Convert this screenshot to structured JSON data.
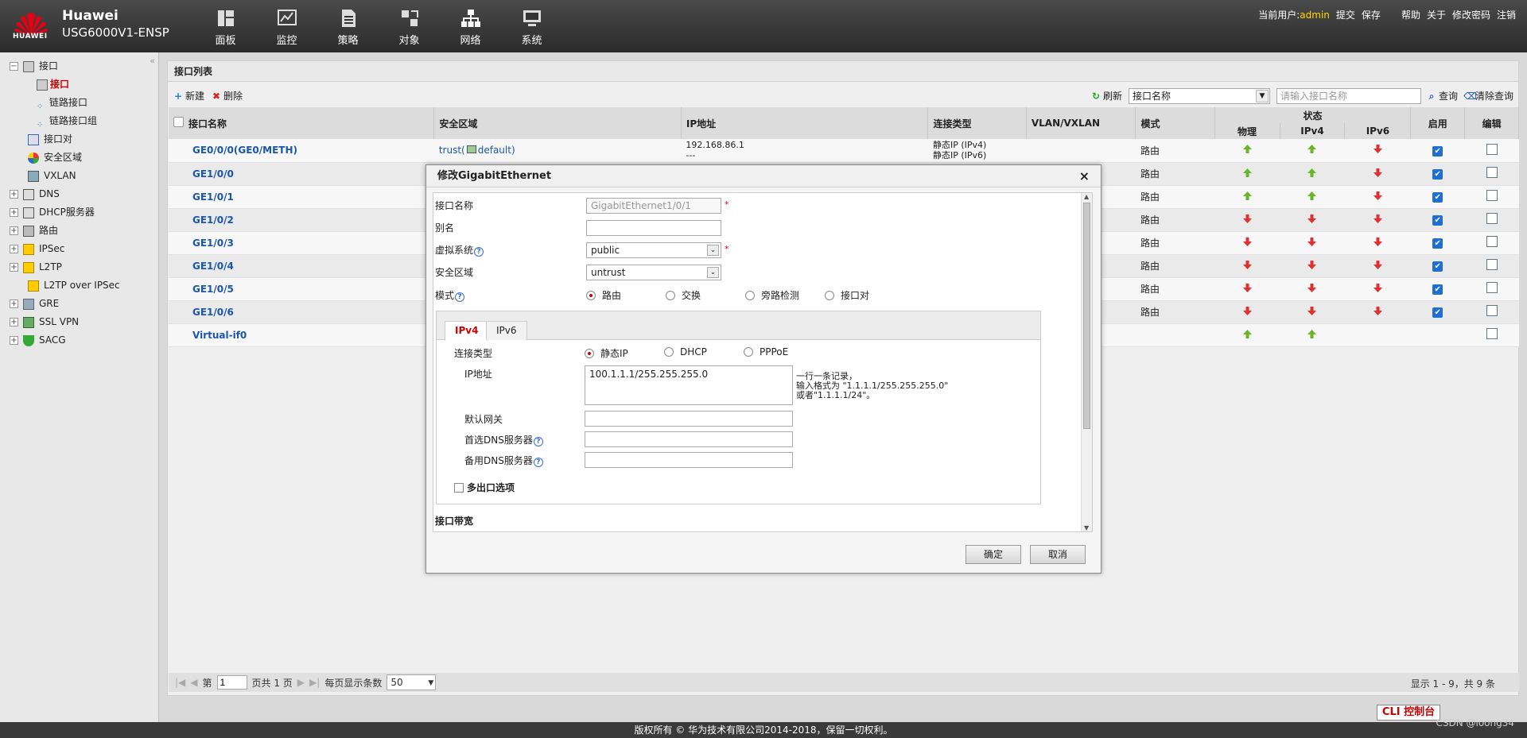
{
  "header": {
    "brand": "Huawei",
    "model": "USG6000V1-ENSP",
    "logo_text": "HUAWEI"
  },
  "nav": [
    {
      "label": "面板",
      "icon": "dashboard-icon"
    },
    {
      "label": "监控",
      "icon": "monitor-icon"
    },
    {
      "label": "策略",
      "icon": "policy-icon"
    },
    {
      "label": "对象",
      "icon": "object-icon"
    },
    {
      "label": "网络",
      "icon": "network-icon"
    },
    {
      "label": "系统",
      "icon": "system-icon"
    }
  ],
  "toplinks": {
    "user_label": "当前用户:",
    "user": "admin",
    "submit": "提交",
    "save": "保存",
    "help": "帮助",
    "about": "关于",
    "change_pwd": "修改密码",
    "logout": "注销"
  },
  "sidebar": {
    "items": [
      {
        "label": "接口",
        "pm": "−"
      },
      {
        "label": "接口",
        "selected": true
      },
      {
        "label": "链路接口"
      },
      {
        "label": "链路接口组"
      },
      {
        "label": "接口对"
      },
      {
        "label": "安全区域"
      },
      {
        "label": "VXLAN"
      },
      {
        "label": "DNS",
        "pm": "+"
      },
      {
        "label": "DHCP服务器",
        "pm": "+"
      },
      {
        "label": "路由",
        "pm": "+"
      },
      {
        "label": "IPSec",
        "pm": "+"
      },
      {
        "label": "L2TP",
        "pm": "+"
      },
      {
        "label": "L2TP over IPSec"
      },
      {
        "label": "GRE",
        "pm": "+"
      },
      {
        "label": "SSL VPN",
        "pm": "+"
      },
      {
        "label": "SACG",
        "pm": "+"
      }
    ]
  },
  "main": {
    "title": "接口列表",
    "new": "新建",
    "delete": "删除",
    "refresh": "刷新",
    "search_field": "接口名称",
    "search_placeholder": "请输入接口名称",
    "query": "查询",
    "clear": "清除查询",
    "columns": {
      "name": "接口名称",
      "zone": "安全区域",
      "ip": "IP地址",
      "conn": "连接类型",
      "vlan": "VLAN/VXLAN",
      "mode": "模式",
      "status": "状态",
      "phys": "物理",
      "ipv4": "IPv4",
      "ipv6": "IPv6",
      "enable": "启用",
      "edit": "编辑"
    },
    "rows": [
      {
        "name": "GE0/0/0(GE0/METH)",
        "zone": "trust(",
        "vsys": "default)",
        "ip": "192.168.86.1",
        "ip2": "---",
        "conn": "静态IP (IPv4)",
        "conn2": "静态IP (IPv6)",
        "mode": "路由",
        "phys": "up",
        "v4": "up",
        "v6": "down"
      },
      {
        "name": "GE1/0/0",
        "mode": "路由",
        "phys": "up",
        "v4": "up",
        "v6": "down"
      },
      {
        "name": "GE1/0/1",
        "mode": "路由",
        "phys": "up",
        "v4": "up",
        "v6": "down"
      },
      {
        "name": "GE1/0/2",
        "mode": "路由",
        "phys": "down",
        "v4": "down",
        "v6": "down"
      },
      {
        "name": "GE1/0/3",
        "mode": "路由",
        "phys": "down",
        "v4": "down",
        "v6": "down"
      },
      {
        "name": "GE1/0/4",
        "mode": "路由",
        "phys": "down",
        "v4": "down",
        "v6": "down"
      },
      {
        "name": "GE1/0/5",
        "mode": "路由",
        "phys": "down",
        "v4": "down",
        "v6": "down"
      },
      {
        "name": "GE1/0/6",
        "mode": "路由",
        "phys": "down",
        "v4": "down",
        "v6": "down"
      },
      {
        "name": "Virtual-if0",
        "mode": "",
        "phys": "up",
        "v4": "up",
        "v6": ""
      }
    ],
    "pager": {
      "page_prefix": "第",
      "page": "1",
      "page_suffix": "页共 1 页",
      "per_page_label": "每页显示条数",
      "per_page": "50",
      "summary": "显示 1 - 9，共 9 条"
    }
  },
  "dialog": {
    "title": "修改GigabitEthernet",
    "name_label": "接口名称",
    "name_value": "GigabitEthernet1/0/1",
    "alias_label": "别名",
    "alias_value": "",
    "vsys_label": "虚拟系统",
    "vsys_value": "public",
    "zone_label": "安全区域",
    "zone_value": "untrust",
    "mode_label": "模式",
    "modes": [
      "路由",
      "交换",
      "旁路检测",
      "接口对"
    ],
    "tabs": [
      "IPv4",
      "IPv6"
    ],
    "conn_label": "连接类型",
    "conn_types": [
      "静态IP",
      "DHCP",
      "PPPoE"
    ],
    "ip_label": "IP地址",
    "ip_value": "100.1.1.1/255.255.255.0",
    "ip_hint1": "一行一条记录，",
    "ip_hint2": "输入格式为 \"1.1.1.1/255.255.255.0\"",
    "ip_hint3": "或者\"1.1.1.1/24\"。",
    "gw_label": "默认网关",
    "dns1_label": "首选DNS服务器",
    "dns2_label": "备用DNS服务器",
    "multi_label": "多出口选项",
    "bw_label": "接口带宽",
    "ok": "确定",
    "cancel": "取消"
  },
  "cli": "CLI 控制台",
  "footer": "版权所有 © 华为技术有限公司2014-2018，保留一切权利。",
  "watermark": "CSDN @loong34",
  "colors": {
    "up": "#6bb52a",
    "down": "#e23030",
    "link": "#1a56b0",
    "accent": "#c00000"
  }
}
